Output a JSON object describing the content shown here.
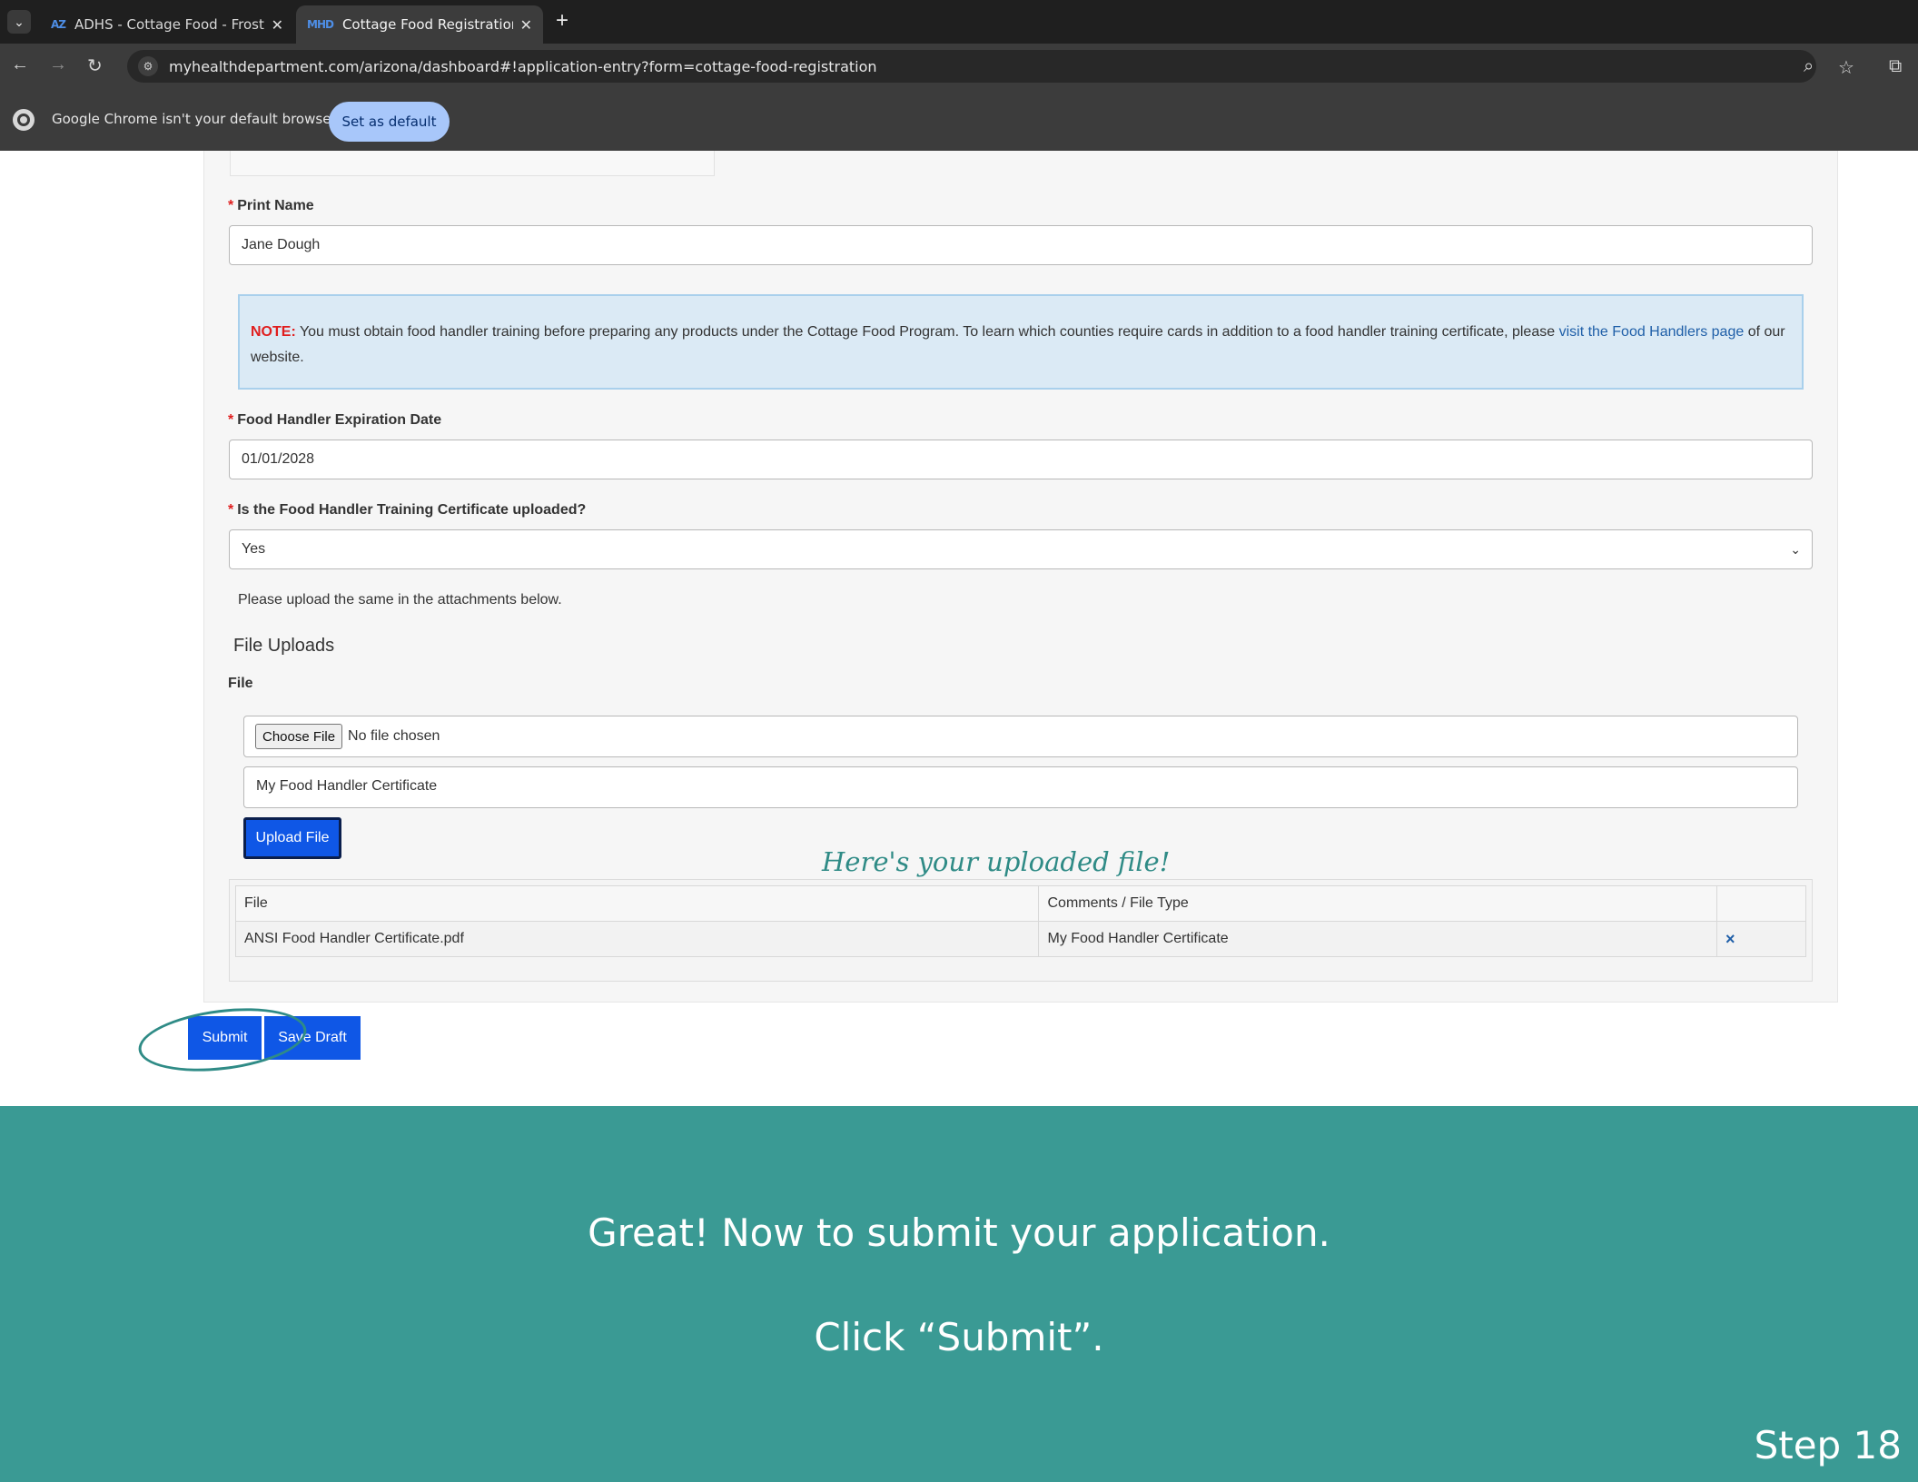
{
  "browser": {
    "tabs": [
      {
        "favicon": "AZ",
        "title": "ADHS - Cottage Food - Frosting"
      },
      {
        "favicon": "MHD",
        "title": "Cottage Food Registration | Ari"
      }
    ],
    "url": "myhealthdepartment.com/arizona/dashboard#!application-entry?form=cottage-food-registration",
    "infobar_text": "Google Chrome isn't your default browser",
    "set_default_label": "Set as default"
  },
  "form": {
    "print_name": {
      "label": "Print Name",
      "value": "Jane Dough"
    },
    "note": {
      "label": "NOTE:",
      "text": " You must obtain food handler training before preparing any products under the Cottage Food Program. To learn which counties require cards in addition to a food handler training certificate, please ",
      "link": "visit the Food Handlers page",
      "tail": " of our website."
    },
    "expiration": {
      "label": "Food Handler Expiration Date",
      "value": "01/01/2028"
    },
    "certificate_uploaded": {
      "label": "Is the Food Handler Training Certificate uploaded?",
      "value": "Yes"
    },
    "upload_hint": "Please upload the same in the attachments below.",
    "file_uploads_heading": "File Uploads",
    "file_label": "File",
    "choose_file_label": "Choose File",
    "no_file_text": "No file chosen",
    "comment_value": "My Food Handler Certificate",
    "upload_button": "Upload File",
    "table": {
      "headers": [
        "File",
        "Comments / File Type",
        ""
      ],
      "rows": [
        {
          "file": "ANSI Food Handler Certificate.pdf",
          "comment": "My Food Handler Certificate",
          "action": "×"
        }
      ]
    },
    "submit_label": "Submit",
    "save_draft_label": "Save Draft"
  },
  "annotation": {
    "handwritten_note": "Here's your uploaded file!"
  },
  "banner": {
    "line1": "Great! Now to submit your application.",
    "line2": "Click “Submit”.",
    "step": "Step 18"
  },
  "colors": {
    "primary_button": "#0f57e6",
    "banner_bg": "#3a9a94",
    "required": "#e01e1e"
  }
}
